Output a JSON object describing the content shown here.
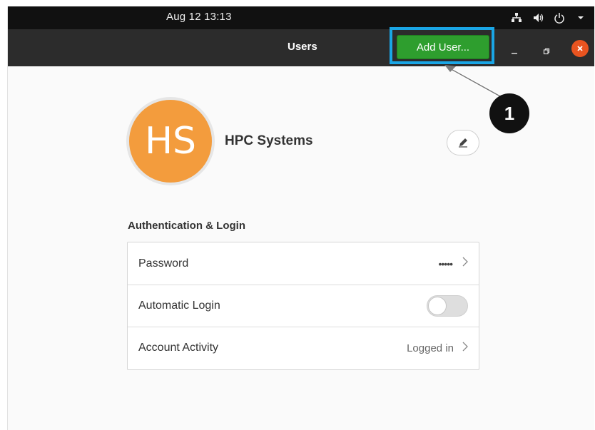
{
  "system_bar": {
    "clock": "Aug 12  13:13",
    "tray_icons": [
      "network-icon",
      "volume-icon",
      "power-icon",
      "chevron-down-icon"
    ]
  },
  "header": {
    "title": "Users",
    "add_user_label": "Add User...",
    "window_controls": [
      "minimize",
      "maximize",
      "close"
    ]
  },
  "callout": {
    "number": "1"
  },
  "user": {
    "initials": "HS",
    "name": "HPC Systems",
    "avatar_color": "#f39c3d"
  },
  "auth_section": {
    "title": "Authentication & Login",
    "rows": [
      {
        "label": "Password",
        "value": "•••••"
      },
      {
        "label": "Automatic Login",
        "toggle": false
      },
      {
        "label": "Account Activity",
        "value": "Logged in"
      }
    ]
  },
  "colors": {
    "accent_green": "#2e9e2e",
    "highlight_blue": "#1aa6e6",
    "close_orange": "#e95420",
    "header_bg": "#2c2c2c"
  }
}
